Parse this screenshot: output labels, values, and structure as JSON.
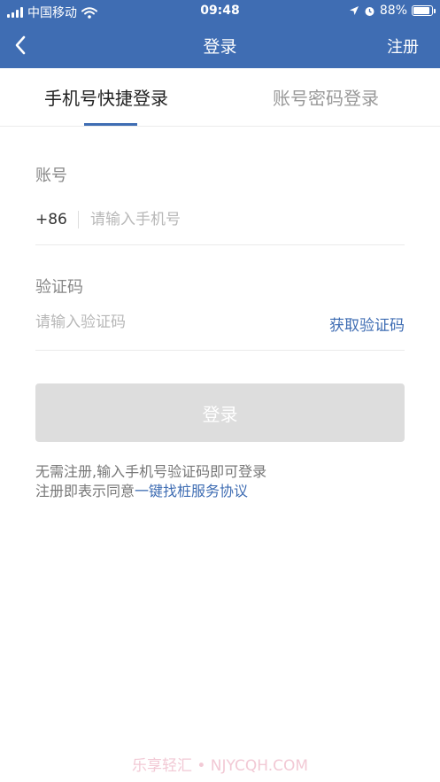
{
  "status_bar": {
    "carrier": "中国移动",
    "time": "09:48",
    "battery_text": "88%",
    "battery_level": 0.88,
    "icons": [
      "signal-icon",
      "wifi-icon",
      "location-icon",
      "alarm-icon",
      "battery-icon"
    ]
  },
  "nav": {
    "title": "登录",
    "right_action": "注册",
    "back_icon": "chevron-left-icon"
  },
  "tabs": [
    {
      "label": "手机号快捷登录",
      "active": true
    },
    {
      "label": "账号密码登录",
      "active": false
    }
  ],
  "form": {
    "account_label": "账号",
    "country_code": "+86",
    "phone_placeholder": "请输入手机号",
    "code_label": "验证码",
    "code_placeholder": "请输入验证码",
    "get_code_label": "获取验证码"
  },
  "login_button": "登录",
  "notes": {
    "line1": "无需注册,输入手机号验证码即可登录",
    "line2_prefix": "注册即表示同意",
    "agreement_link": "一键找桩服务协议"
  },
  "watermark": "乐享轻汇 • NJYCQH.COM",
  "colors": {
    "primary": "#3f6db3",
    "button_disabled": "#dddddd",
    "placeholder": "#b8b8b8"
  }
}
